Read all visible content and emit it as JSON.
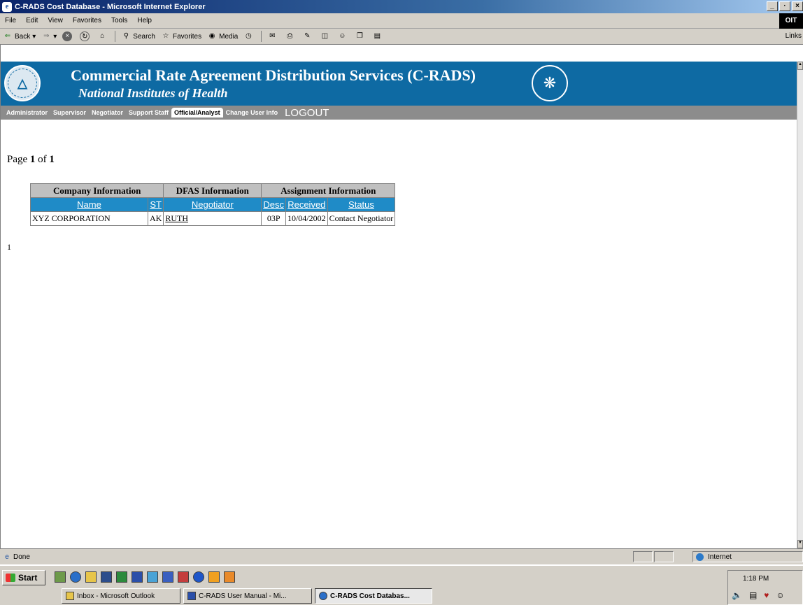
{
  "window": {
    "title": "C-RADS Cost Database - Microsoft Internet Explorer",
    "buttons": [
      "_",
      "·",
      "×"
    ]
  },
  "menu": [
    "File",
    "Edit",
    "View",
    "Favorites",
    "Tools",
    "Help"
  ],
  "brand_logo": "OIT",
  "toolbar": {
    "back": "Back",
    "search": "Search",
    "favorites": "Favorites",
    "media": "Media",
    "links": "Links"
  },
  "banner": {
    "title": "Commercial Rate Agreement Distribution Services (C-RADS)",
    "subtitle": "National Institutes of Health",
    "color": "#0e6aa3"
  },
  "nav": {
    "items": [
      "Administrator",
      "Supervisor",
      "Negotiator",
      "Support Staff",
      "Official/Analyst",
      "Change User Info"
    ],
    "active": "Official/Analyst",
    "logout": "LOGOUT"
  },
  "paging": {
    "label_page": "Page",
    "current": "1",
    "label_of": "of",
    "total": "1"
  },
  "table": {
    "groups": [
      "Company Information",
      "DFAS Information",
      "Assignment Information"
    ],
    "columns": [
      "Name",
      "ST",
      "Negotiator",
      "Desc",
      "Received",
      "Status"
    ],
    "rows": [
      [
        "XYZ CORPORATION",
        "AK",
        "RUTH",
        "03P",
        "10/04/2002",
        "Contact Negotiator"
      ]
    ],
    "header_color": "#1f8bc7"
  },
  "page_index": "1",
  "status": {
    "text": "Done",
    "zone": "Internet"
  },
  "taskbar": {
    "start": "Start",
    "tasks": [
      "Inbox - Microsoft Outlook",
      "C-RADS User Manual - Mi...",
      "C-RADS Cost Databas..."
    ],
    "clock": "1:18 PM"
  }
}
